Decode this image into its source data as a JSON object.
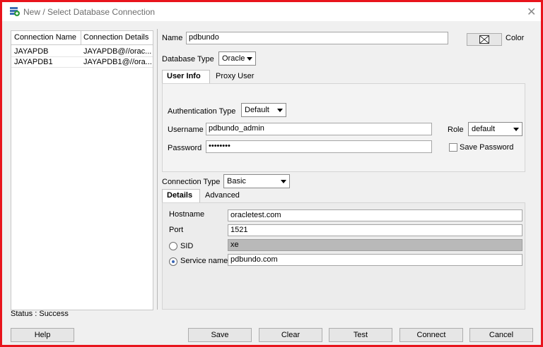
{
  "window": {
    "title": "New / Select Database Connection",
    "close_glyph": "✕"
  },
  "connections": {
    "headers": [
      "Connection Name",
      "Connection Details"
    ],
    "rows": [
      {
        "name": "JAYAPDB",
        "details": "JAYAPDB@//orac..."
      },
      {
        "name": "JAYAPDB1",
        "details": "JAYAPDB1@//ora..."
      }
    ]
  },
  "status": "Status : Success",
  "form": {
    "name_label": "Name",
    "name_value": "pdbundo",
    "color_label": "Color",
    "dbtype_label": "Database Type",
    "dbtype_value": "Oracle",
    "tabs_top": [
      "User Info",
      "Proxy User"
    ],
    "auth_label": "Authentication Type",
    "auth_value": "Default",
    "username_label": "Username",
    "username_value": "pdbundo_admin",
    "password_label": "Password",
    "password_value": "••••••••",
    "role_label": "Role",
    "role_value": "default",
    "save_password_label": "Save Password",
    "conn_type_label": "Connection Type",
    "conn_type_value": "Basic",
    "tabs_bottom": [
      "Details",
      "Advanced"
    ],
    "hostname_label": "Hostname",
    "hostname_value": "oracletest.com",
    "port_label": "Port",
    "port_value": "1521",
    "sid_label": "SID",
    "sid_value": "xe",
    "service_label": "Service name",
    "service_value": "pdbundo.com"
  },
  "buttons": {
    "help": "Help",
    "save": "Save",
    "clear": "Clear",
    "test": "Test",
    "connect": "Connect",
    "cancel": "Cancel"
  },
  "colors": {
    "frame": "#e8141c",
    "radio_dot": "#3a66b5"
  }
}
